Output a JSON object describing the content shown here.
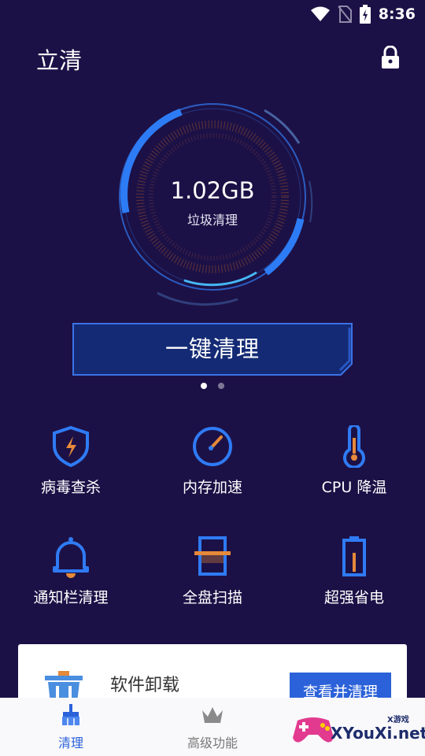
{
  "status_bar": {
    "time": "8:36",
    "icons": [
      "wifi-icon",
      "no-sim-icon",
      "battery-charging-icon"
    ]
  },
  "header": {
    "title": "立清",
    "lock_icon": "lock-icon"
  },
  "summary": {
    "junk_size": "1.02GB",
    "junk_label": "垃圾清理"
  },
  "primary_action": {
    "label": "一键清理"
  },
  "pager": {
    "pages": 2,
    "active": 0
  },
  "tools": [
    {
      "label": "病毒查杀",
      "icon": "shield-bolt-icon"
    },
    {
      "label": "内存加速",
      "icon": "speedometer-icon"
    },
    {
      "label": "CPU 降温",
      "icon": "thermometer-icon"
    },
    {
      "label": "通知栏清理",
      "icon": "bell-icon"
    },
    {
      "label": "全盘扫描",
      "icon": "scan-icon"
    },
    {
      "label": "超强省电",
      "icon": "battery-icon"
    }
  ],
  "card": {
    "title": "软件卸载",
    "button_label": "查看并清理",
    "icon": "trash-icon"
  },
  "bottom_nav": [
    {
      "label": "清理",
      "icon": "broom-icon",
      "active": true
    },
    {
      "label": "高级功能",
      "icon": "crown-icon",
      "active": false
    }
  ],
  "watermark": {
    "text": "XYouXi.net",
    "small": "X游戏"
  },
  "colors": {
    "background": "#1c1146",
    "accent": "#2f7bf5",
    "orange": "#e5893a",
    "nav_active": "#2c62d9",
    "nav_inactive": "#777777"
  }
}
